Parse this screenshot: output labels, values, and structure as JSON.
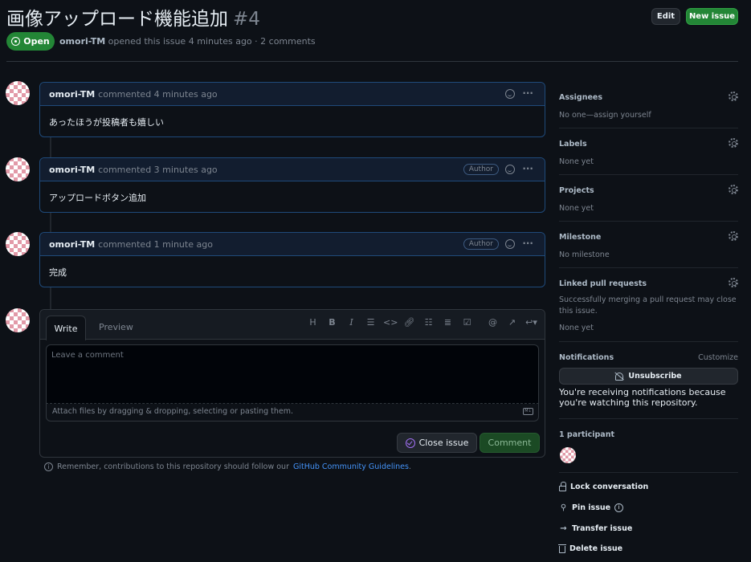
{
  "issue": {
    "title": "画像アップロード機能追加",
    "number": "#4",
    "state": "Open",
    "author": "omori-TM",
    "meta_text": "opened this issue 4 minutes ago · 2 comments"
  },
  "header_buttons": {
    "edit": "Edit",
    "new_issue": "New issue"
  },
  "comments": [
    {
      "author": "omori-TM",
      "time": "commented 4 minutes ago",
      "badge": "",
      "body": "あったほうが投稿者も嬉しい"
    },
    {
      "author": "omori-TM",
      "time": "commented 3 minutes ago",
      "badge": "Author",
      "body": "アップロードボタン追加"
    },
    {
      "author": "omori-TM",
      "time": "commented 1 minute ago",
      "badge": "Author",
      "body": "完成"
    }
  ],
  "composer": {
    "tab_write": "Write",
    "tab_preview": "Preview",
    "placeholder": "Leave a comment",
    "attach_hint": "Attach files by dragging & dropping, selecting or pasting them.",
    "close_button": "Close issue",
    "comment_button": "Comment",
    "toolbar_icons": [
      "heading-icon",
      "bold-icon",
      "italic-icon",
      "quote-icon",
      "code-icon",
      "link-icon",
      "bulleted-list-icon",
      "numbered-list-icon",
      "task-list-icon",
      "mention-icon",
      "cross-reference-icon",
      "saved-replies-icon"
    ]
  },
  "guidelines": {
    "text": "Remember, contributions to this repository should follow our",
    "link": "GitHub Community Guidelines",
    "suffix": "."
  },
  "sidebar": {
    "assignees": {
      "label": "Assignees",
      "value": "No one—assign yourself"
    },
    "labels": {
      "label": "Labels",
      "value": "None yet"
    },
    "projects": {
      "label": "Projects",
      "value": "None yet"
    },
    "milestone": {
      "label": "Milestone",
      "value": "No milestone"
    },
    "linked_prs": {
      "label": "Linked pull requests",
      "desc": "Successfully merging a pull request may close this issue.",
      "value": "None yet"
    },
    "notifications": {
      "label": "Notifications",
      "customize": "Customize",
      "button": "Unsubscribe",
      "desc": "You're receiving notifications because you're watching this repository."
    },
    "participants": {
      "label": "1 participant"
    },
    "actions": {
      "lock": "Lock conversation",
      "pin": "Pin issue",
      "transfer": "Transfer issue",
      "delete": "Delete issue"
    }
  },
  "colors": {
    "background": "#0d1117",
    "open_green": "#238636",
    "link_blue": "#4493f8",
    "comment_border": "#1f4a7a",
    "close_purple": "#a371f7"
  }
}
